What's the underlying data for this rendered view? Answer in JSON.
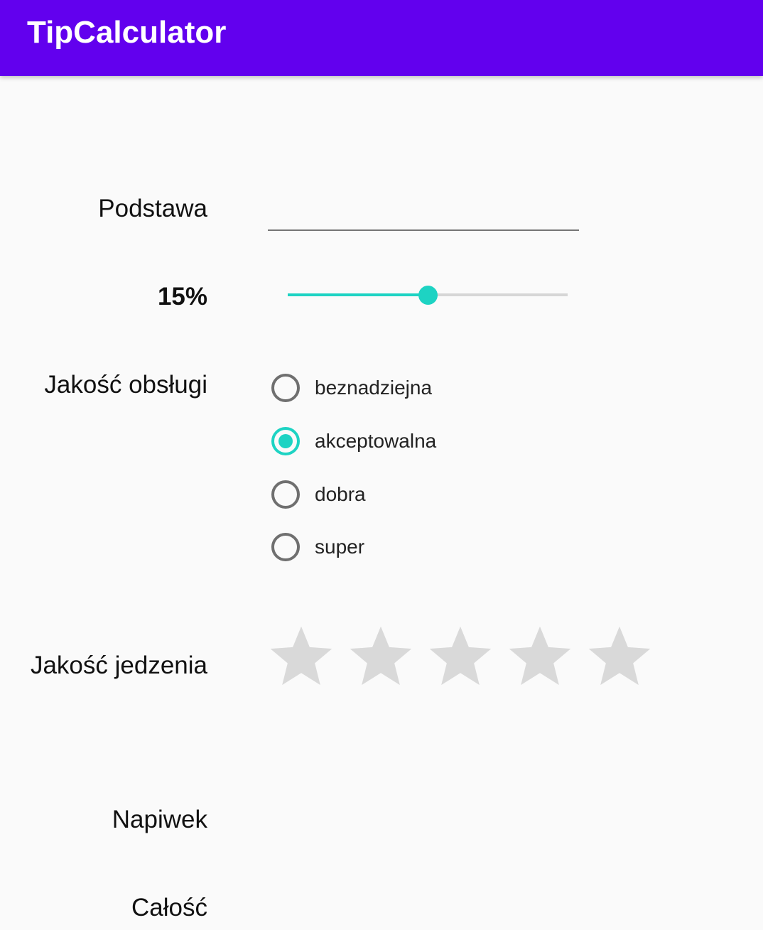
{
  "appbar": {
    "title": "TipCalculator"
  },
  "form": {
    "base_label": "Podstawa",
    "base_value": "",
    "percent_label": "15%",
    "percent_value": 0.5,
    "service_label": "Jakość obsługi",
    "service_options": [
      {
        "label": "beznadziejna",
        "checked": false
      },
      {
        "label": "akceptowalna",
        "checked": true
      },
      {
        "label": "dobra",
        "checked": false
      },
      {
        "label": "super",
        "checked": false
      }
    ],
    "food_label": "Jakość jedzenia",
    "food_rating": 0,
    "food_rating_max": 5,
    "tip_label": "Napiwek",
    "total_label": "Całość"
  },
  "colors": {
    "appbar": "#6200ee",
    "accent": "#1dd3c3",
    "star_empty": "#d9d9d9"
  }
}
